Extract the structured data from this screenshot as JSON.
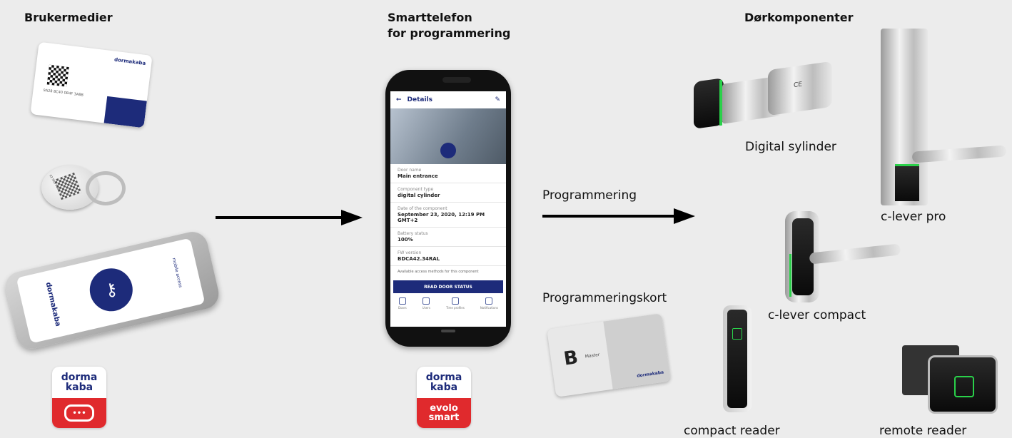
{
  "headings": {
    "left": "Brukermedier",
    "middle": "Smarttelefon\nfor programmering",
    "right": "Dørkomponenter"
  },
  "labels": {
    "programming": "Programmering",
    "programming_card": "Programmeringskort",
    "digital_cylinder": "Digital sylinder",
    "c_lever_pro": "c-lever pro",
    "c_lever_compact": "c-lever compact",
    "compact_reader": "compact reader",
    "remote_reader": "remote reader"
  },
  "app_screen": {
    "title": "Details",
    "rows": [
      {
        "label": "Door name",
        "value": "Main entrance"
      },
      {
        "label": "Component type",
        "value": "digital cylinder"
      },
      {
        "label": "Date of the component",
        "value": "September 23, 2020, 12:19 PM GMT+2"
      },
      {
        "label": "Battery status",
        "value": "100%"
      },
      {
        "label": "FW version",
        "value": "BDCA42.34RAL"
      }
    ],
    "access_methods": "Available access methods for this component",
    "button": "READ DOOR STATUS",
    "nav": [
      "Doors",
      "Users",
      "Time profiles",
      "Notifications"
    ]
  },
  "logos": {
    "brand_line1": "dorma",
    "brand_line2": "kaba",
    "evolo_line1": "evolo",
    "evolo_line2": "smart"
  },
  "card_texts": {
    "brand": "dormakaba",
    "card_id": "9A28 8C40 0B4F 3A8B",
    "keyfob_id": "02 9D5 9CB3",
    "phone_app": "mobile access",
    "prog_letter": "B",
    "prog_word": "Master"
  },
  "colors": {
    "background": "#ececec",
    "brand_blue": "#1d2b7a",
    "brand_red": "#e02a2d",
    "led_green": "#2ad14a"
  }
}
